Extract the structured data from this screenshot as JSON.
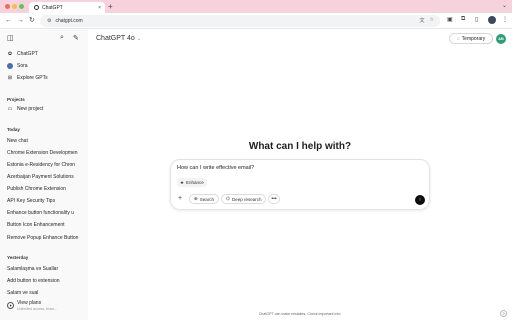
{
  "browser": {
    "tab_title": "ChatGPT",
    "tab_close": "×",
    "new_tab": "+",
    "url": "chatgpt.com",
    "icons": [
      "translate-icon",
      "star-icon",
      "extension-icon",
      "sidebar-icon",
      "profile-avatar"
    ],
    "colors": {
      "tabstrip": "#f6d3dc",
      "close": "#ee6a5f",
      "minimize": "#f5bd4f",
      "maximize": "#61c454"
    }
  },
  "sidebar": {
    "nav": [
      {
        "label": "ChatGPT",
        "icon": "chatgpt-logo-icon"
      },
      {
        "label": "Sora",
        "icon": "sora-icon"
      },
      {
        "label": "Explore GPTs",
        "icon": "grid-icon"
      }
    ],
    "projects_heading": "Projects",
    "new_project": "New project",
    "today_heading": "Today",
    "today_chats": [
      "New chat",
      "Chrome Extension Developmen",
      "Estonia e-Residency for Chron",
      "Azerbaijan Payment Solutions",
      "Publish Chrome Extension",
      "API Key Security Tips",
      "Enhance button functionality u",
      "Button Icon Enhancement",
      "Remove Popup Enhance Button"
    ],
    "yesterday_heading": "Yesterday",
    "yesterday_chats": [
      "Salamlaşma və Suallar",
      "Add button to extension",
      "Salam ve sual"
    ],
    "plans": {
      "title": "View plans",
      "subtitle": "Unlimited access, team..."
    }
  },
  "main": {
    "model_name": "ChatGPT 4o",
    "temporary_label": "Temporary",
    "avatar_initials": "AB",
    "heading": "What can I help with?",
    "composer_text": "How can I write effective email?",
    "enhance_label": "Enhance",
    "search_label": "Search",
    "deep_research_label": "Deep research",
    "more_label": "•••",
    "disclaimer": "ChatGPT can make mistakes. Check important info.",
    "help_label": "?"
  }
}
